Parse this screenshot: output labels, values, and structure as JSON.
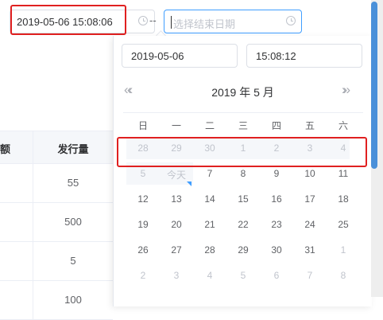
{
  "range": {
    "start_value": "2019-05-06 15:08:06",
    "separator": "--",
    "end_placeholder": "选择结束日期"
  },
  "table": {
    "headers": [
      "额",
      "发行量"
    ],
    "rows": [
      "55",
      "500",
      "5",
      "100"
    ]
  },
  "picker": {
    "date_value": "2019-05-06",
    "time_value": "15:08:12",
    "prev_year_icon": "«‹",
    "next_year_icon": "›»",
    "month_label": "2019 年  5 月",
    "weekdays": [
      "日",
      "一",
      "二",
      "三",
      "四",
      "五",
      "六"
    ],
    "weeks": [
      [
        "28",
        "29",
        "30",
        "1",
        "2",
        "3",
        "4"
      ],
      [
        "5",
        "今天",
        "7",
        "8",
        "9",
        "10",
        "11"
      ],
      [
        "12",
        "13",
        "14",
        "15",
        "16",
        "17",
        "18"
      ],
      [
        "19",
        "20",
        "21",
        "22",
        "23",
        "24",
        "25"
      ],
      [
        "26",
        "27",
        "28",
        "29",
        "30",
        "31",
        "1"
      ],
      [
        "2",
        "3",
        "4",
        "5",
        "6",
        "7",
        "8"
      ]
    ]
  },
  "colors": {
    "accent": "#409eff",
    "highlight": "#e02020",
    "scroll_thumb": "#4a90d9"
  }
}
